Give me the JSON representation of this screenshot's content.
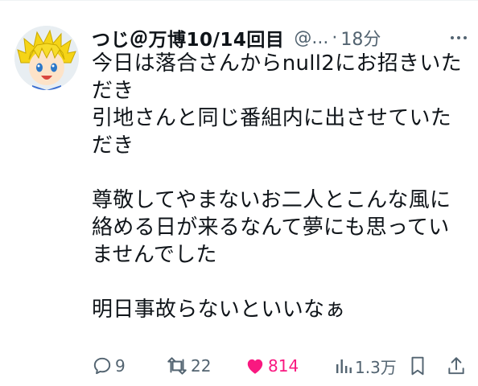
{
  "tweet": {
    "author": {
      "display_name": "つじ＠万博10/14回目",
      "handle": "@...",
      "avatar_icon": "cartoon-avatar-blonde-character"
    },
    "separator": "·",
    "timestamp": "18分",
    "body_lines": [
      "今日は落合さんからnull2にお招きいた",
      "だき",
      "引地さんと同じ番組内に出させていた",
      "だき",
      "",
      "尊敬してやまないお二人とこんな風に",
      "絡める日が来るなんて夢にも思ってい",
      "ませんでした",
      "",
      "明日事故らないといいなぁ"
    ],
    "actions": {
      "reply_count": "9",
      "retweet_count": "22",
      "like_count": "814",
      "view_count": "1.3万"
    },
    "colors": {
      "text": "#0f1419",
      "muted": "#536471",
      "like": "#f91880"
    },
    "icons": [
      "more-icon",
      "reply-icon",
      "retweet-icon",
      "heart-icon",
      "views-icon",
      "bookmark-icon",
      "share-icon"
    ]
  }
}
